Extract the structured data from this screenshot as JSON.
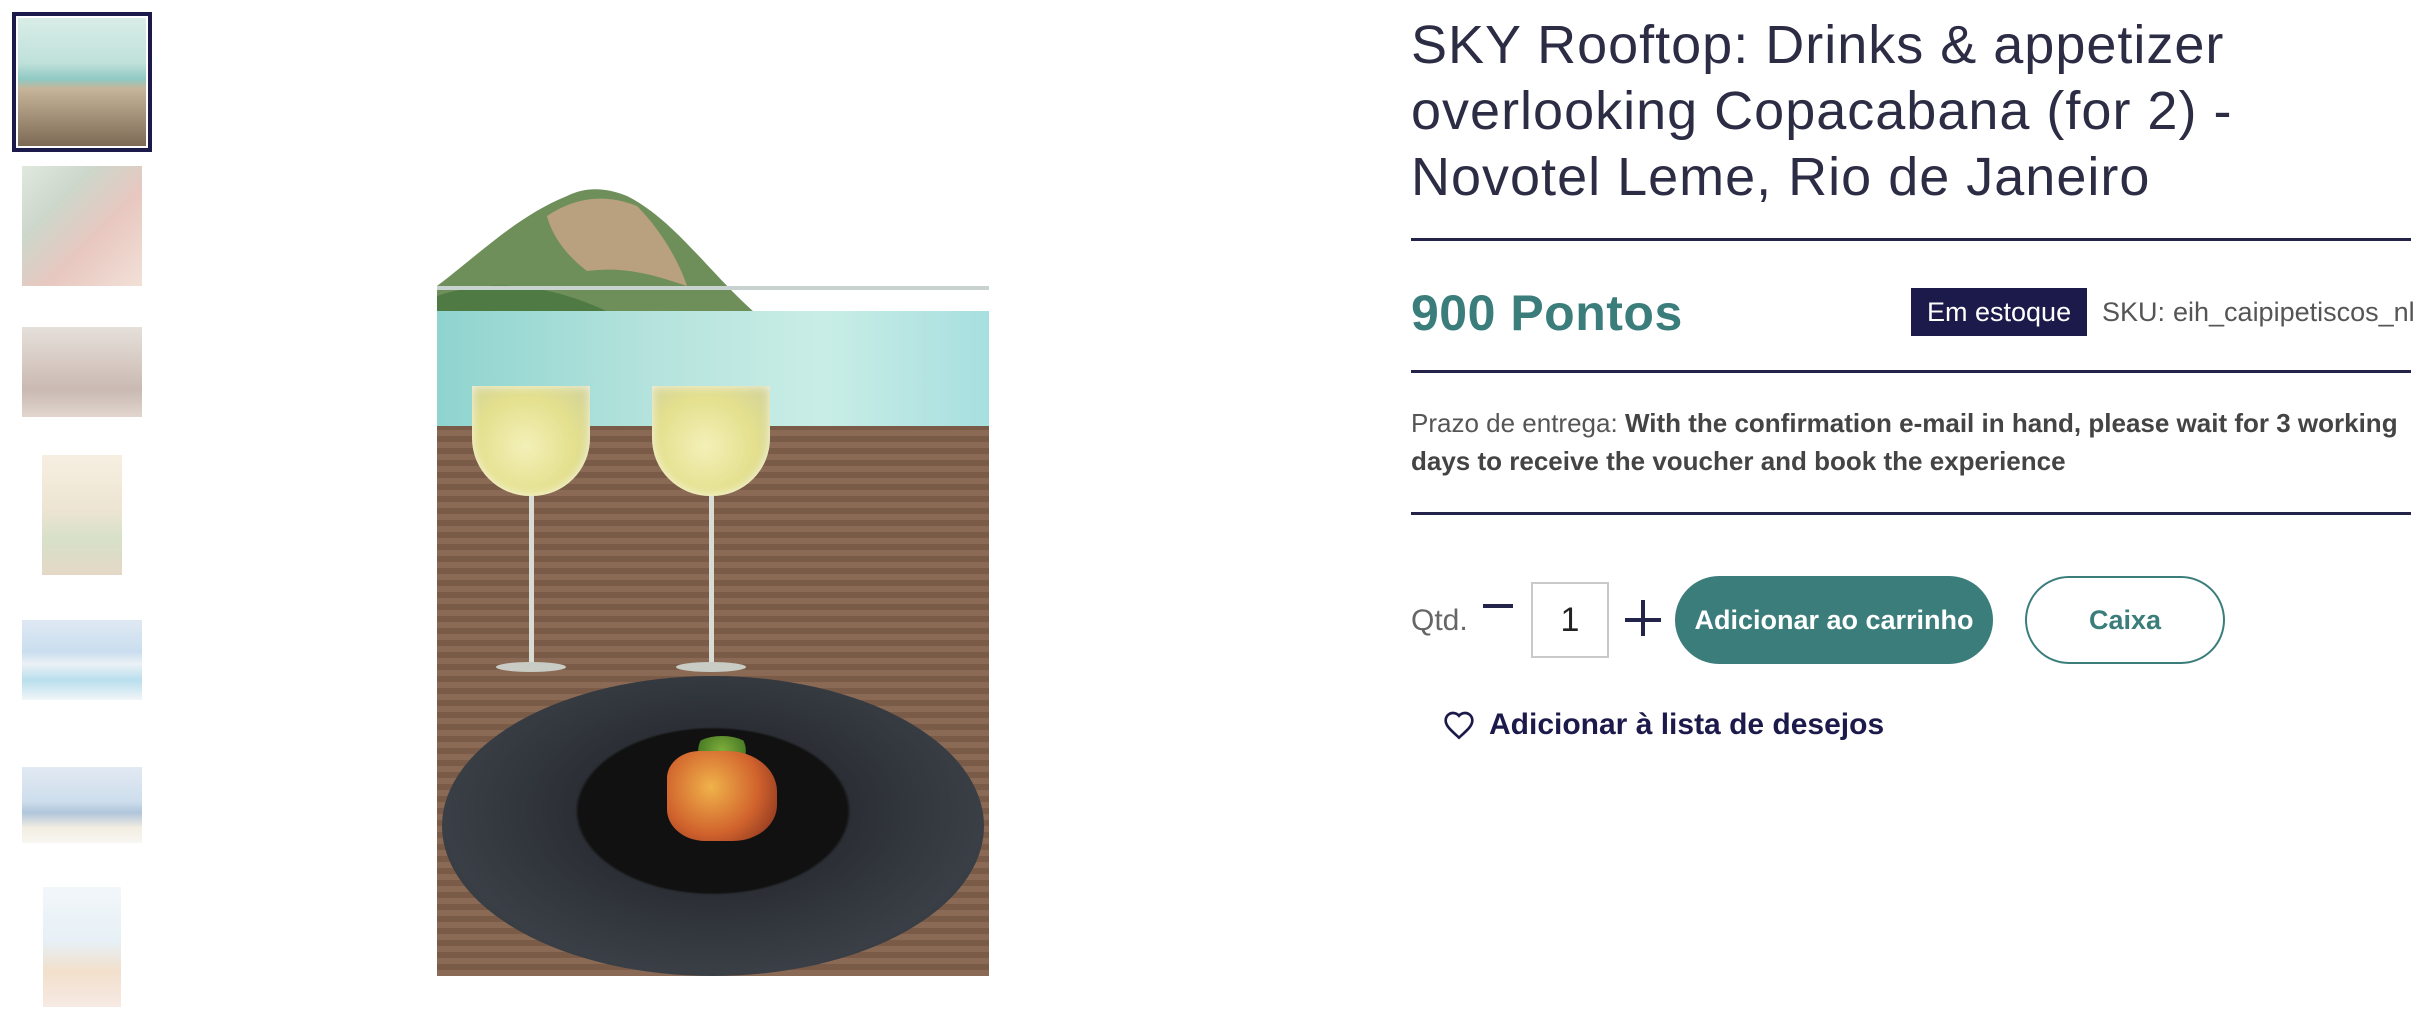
{
  "product": {
    "title": "SKY Rooftop: Drinks & appetizer overlooking Copacabana (for 2) - Novotel Leme, Rio de Janeiro",
    "price": "900 Pontos",
    "stock_badge": "Em estoque",
    "sku_label": "SKU:",
    "sku_value": "eih_caipipetiscos_nl",
    "delivery_label": "Prazo de entrega:",
    "delivery_text": "With the confirmation e-mail in hand, please wait for 3 working days to receive the voucher and book the experience"
  },
  "purchase": {
    "qty_label": "Qtd.",
    "qty_value": "1",
    "add_to_cart_label": "Adicionar ao carrinho",
    "checkout_label": "Caixa",
    "wishlist_label": "Adicionar à lista de desejos"
  },
  "gallery": {
    "thumbnails": [
      "thumbnail-1",
      "thumbnail-2",
      "thumbnail-3",
      "thumbnail-4",
      "thumbnail-5",
      "thumbnail-6",
      "thumbnail-7"
    ],
    "active_index": 0
  },
  "colors": {
    "accent": "#3a7d7b",
    "navy": "#1c1a4b",
    "rule": "#24234a"
  },
  "icons": {
    "minus": "minus-icon",
    "plus": "plus-icon",
    "wishlist": "heart-icon"
  }
}
